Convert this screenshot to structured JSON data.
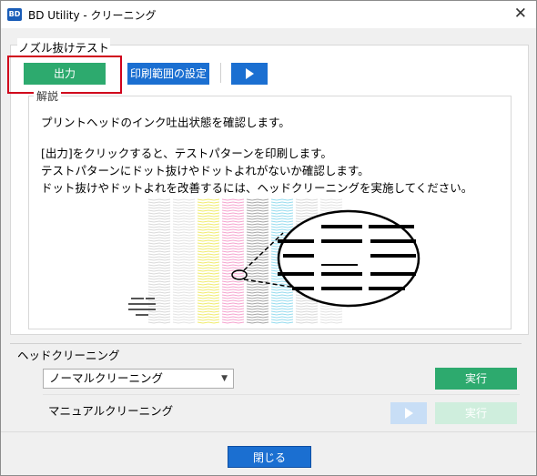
{
  "window": {
    "icon_text": "BD",
    "title": "BD Utility - クリーニング",
    "close_glyph": "✕"
  },
  "nozzle_test": {
    "section_title": "ノズル抜けテスト",
    "output_button": "出力",
    "print_range_button": "印刷範囲の設定",
    "explanation": {
      "legend": "解説",
      "line1": "プリントヘッドのインク吐出状態を確認します。",
      "line2": "[出力]をクリックすると、テストパターンを印刷します。",
      "line3": "テストパターンにドット抜けやドットよれがないか確認します。",
      "line4": "ドット抜けやドットよれを改善するには、ヘッドクリーニングを実施してください。"
    }
  },
  "head_cleaning": {
    "section_title": "ヘッドクリーニング",
    "mode_selected": "ノーマルクリーニング",
    "run_button": "実行",
    "manual_label": "マニュアルクリーニング",
    "manual_run_button": "実行"
  },
  "footer": {
    "close_button": "閉じる"
  },
  "colors": {
    "green": "#2daa6e",
    "blue": "#1b6fd1",
    "highlight_red": "#d0021b"
  }
}
